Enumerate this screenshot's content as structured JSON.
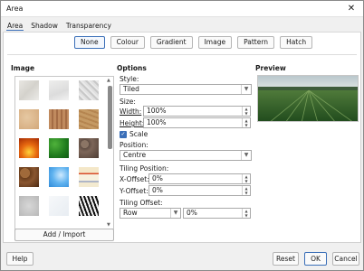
{
  "window": {
    "title": "Area"
  },
  "tabs": [
    {
      "label": "Area",
      "active": true
    },
    {
      "label": "Shadow",
      "active": false
    },
    {
      "label": "Transparency",
      "active": false
    }
  ],
  "modes": [
    {
      "label": "None",
      "selected": true
    },
    {
      "label": "Colour",
      "selected": false
    },
    {
      "label": "Gradient",
      "selected": false
    },
    {
      "label": "Image",
      "selected": false
    },
    {
      "label": "Pattern",
      "selected": false
    },
    {
      "label": "Hatch",
      "selected": false
    }
  ],
  "image_section": {
    "heading": "Image",
    "add_button": "Add / Import",
    "tiles": [
      "painted-white",
      "paper-texture",
      "paper-crumpled",
      "parchment",
      "fence",
      "wood",
      "fire",
      "leaves",
      "stone",
      "pebbles",
      "sky",
      "invoice-paper",
      "concrete",
      "frosted-glass",
      "zebra"
    ]
  },
  "options": {
    "heading": "Options",
    "style_label": "Style:",
    "style_value": "Tiled",
    "size_label": "Size:",
    "width_label": "Width:",
    "width_value": "100%",
    "height_label": "Height:",
    "height_value": "100%",
    "scale_label": "Scale",
    "scale_checked": true,
    "position_label": "Position:",
    "position_value": "Centre",
    "tiling_position_label": "Tiling Position:",
    "x_offset_label": "X-Offset:",
    "x_offset_value": "0%",
    "y_offset_label": "Y-Offset:",
    "y_offset_value": "0%",
    "tiling_offset_label": "Tiling Offset:",
    "tiling_offset_mode": "Row",
    "tiling_offset_value": "0%"
  },
  "preview": {
    "heading": "Preview",
    "image": "green-wheat-field"
  },
  "footer": {
    "help": "Help",
    "reset": "Reset",
    "ok": "OK",
    "cancel": "Cancel"
  },
  "colors": {
    "accent": "#3b6fb8",
    "dialog_bg": "#f0f0f0",
    "page_bg": "#ffffff"
  }
}
